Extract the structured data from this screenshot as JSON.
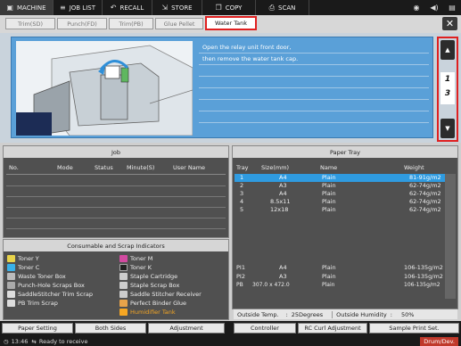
{
  "topbar": {
    "items": [
      {
        "label": "MACHINE",
        "icon": "printer-icon"
      },
      {
        "label": "JOB LIST",
        "icon": "list-icon"
      },
      {
        "label": "RECALL",
        "icon": "recall-icon"
      },
      {
        "label": "STORE",
        "icon": "store-icon"
      },
      {
        "label": "COPY",
        "icon": "copy-icon"
      },
      {
        "label": "SCAN",
        "icon": "scan-icon"
      }
    ]
  },
  "tabs": [
    "Trim(SD)",
    "Punch(FD)",
    "Trim(PB)",
    "Glue Pellet",
    "Water Tank"
  ],
  "instruction": {
    "line1": "Open the relay unit front door,",
    "line2": "then remove the water tank cap.",
    "page_current": "1",
    "page_total": "3"
  },
  "job": {
    "title": "Job",
    "headers": [
      "No.",
      "Mode",
      "Status",
      "Minute(S)",
      "User Name"
    ]
  },
  "consumables": {
    "title": "Consumable and Scrap Indicators",
    "left": [
      "Toner Y",
      "Toner C",
      "Waste Toner Box",
      "Punch-Hole Scraps Box",
      "SaddleStitcher Trim Scrap",
      "PB Trim Scrap"
    ],
    "right": [
      "Toner M",
      "Toner K",
      "Staple Cartridge",
      "Staple Scrap Box",
      "Saddle Stitcher Receiver",
      "Perfect Binder Glue",
      "Humidifier Tank"
    ]
  },
  "tray": {
    "title": "Paper Tray",
    "headers": [
      "Tray",
      "Size(mm)",
      "Name",
      "Weight"
    ],
    "rows": [
      {
        "tray": "1",
        "size": "A4",
        "name": "Plain",
        "weight": "81-91g/m2"
      },
      {
        "tray": "2",
        "size": "A3",
        "name": "Plain",
        "weight": "62-74g/m2"
      },
      {
        "tray": "3",
        "size": "A4",
        "name": "Plain",
        "weight": "62-74g/m2"
      },
      {
        "tray": "4",
        "size": "8.5x11",
        "name": "Plain",
        "weight": "62-74g/m2"
      },
      {
        "tray": "5",
        "size": "12x18",
        "name": "Plain",
        "weight": "62-74g/m2"
      }
    ],
    "rows2": [
      {
        "tray": "PI1",
        "size": "A4",
        "name": "Plain",
        "weight": "106-135g/m2"
      },
      {
        "tray": "PI2",
        "size": "A3",
        "name": "Plain",
        "weight": "106-135g/m2"
      },
      {
        "tray": "PB",
        "size": "307.0 x 472.0",
        "name": "Plain",
        "weight": "106-135g/m2"
      }
    ]
  },
  "status": {
    "temp_label": "Outside Temp.",
    "temp_value": "25Degrees",
    "humidity_label": "Outside Humidity",
    "humidity_value": "50%"
  },
  "footer": {
    "buttons": [
      "Paper Setting",
      "Both Sides",
      "Adjustment",
      "Controller",
      "RC Curl Adjustment",
      "Sample Print Set."
    ],
    "time": "13:46",
    "message": "Ready to receive",
    "badge": "Drum/Dev."
  },
  "colors": {
    "highlight_red": "#e02020",
    "select_blue": "#2f9be0",
    "instr_blue": "#5aa0d8"
  }
}
